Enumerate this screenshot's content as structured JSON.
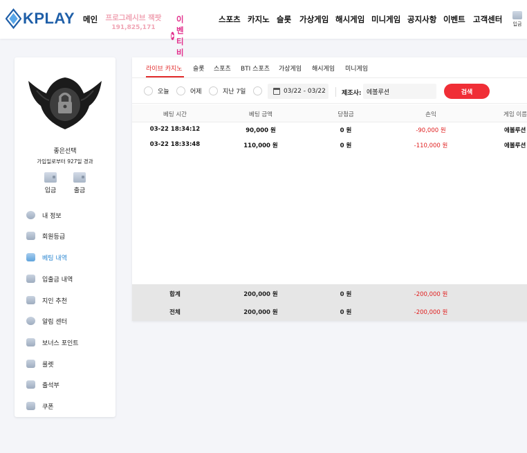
{
  "brand": {
    "logo_text": "KPLAY"
  },
  "nav": {
    "main": "메인",
    "promo_line1": "프로그레시브 잭팟",
    "promo_line2": "191,825,171",
    "event_live": "이벤티비",
    "sports": "스포츠",
    "casino": "카지노",
    "slot": "슬롯",
    "virtual": "가상게임",
    "hash": "해시게임",
    "mini": "미니게임",
    "notice": "공지사항",
    "event": "이벤트",
    "support": "고객센터",
    "deposit": "입금"
  },
  "sidebar": {
    "username": "좋은선택",
    "since": "가입일로부터 927일 경과",
    "deposit_label": "입금",
    "withdraw_label": "출금",
    "items": [
      {
        "label": "내 정보"
      },
      {
        "label": "회원등급"
      },
      {
        "label": "베팅 내역"
      },
      {
        "label": "입출금 내역"
      },
      {
        "label": "지인 추천"
      },
      {
        "label": "알림 센터"
      },
      {
        "label": "보너스 포인트"
      },
      {
        "label": "룰렛"
      },
      {
        "label": "출석부"
      },
      {
        "label": "쿠폰"
      }
    ],
    "active_index": 2
  },
  "tabs": [
    "라이브 카지노",
    "슬롯",
    "스포츠",
    "BTI 스포츠",
    "가상게임",
    "해시게임",
    "미니게임"
  ],
  "filters": {
    "today": "오늘",
    "yesterday": "어제",
    "last7": "지난 7일",
    "date_range": "03/22 - 03/22",
    "maker_label": "제조사:",
    "maker_value": "에볼루션",
    "search_button": "검색"
  },
  "table": {
    "headers": [
      "베팅 시간",
      "베팅 금액",
      "당첨금",
      "손익",
      "게임 이름"
    ],
    "rows": [
      {
        "time": "03-22 18:34:12",
        "bet": "90,000 원",
        "win": "0 원",
        "profit": "-90,000 원",
        "game": "에볼루션"
      },
      {
        "time": "03-22 18:33:48",
        "bet": "110,000 원",
        "win": "0 원",
        "profit": "-110,000 원",
        "game": "에볼루션"
      }
    ],
    "summary": [
      {
        "label": "합계",
        "bet": "200,000 원",
        "win": "0 원",
        "profit": "-200,000 원"
      },
      {
        "label": "전체",
        "bet": "200,000 원",
        "win": "0 원",
        "profit": "-200,000 원"
      }
    ]
  },
  "colors": {
    "accent": "#e22b2b",
    "brand": "#1f5fa8",
    "event": "#e2318d",
    "active_menu": "#2a86d1"
  }
}
